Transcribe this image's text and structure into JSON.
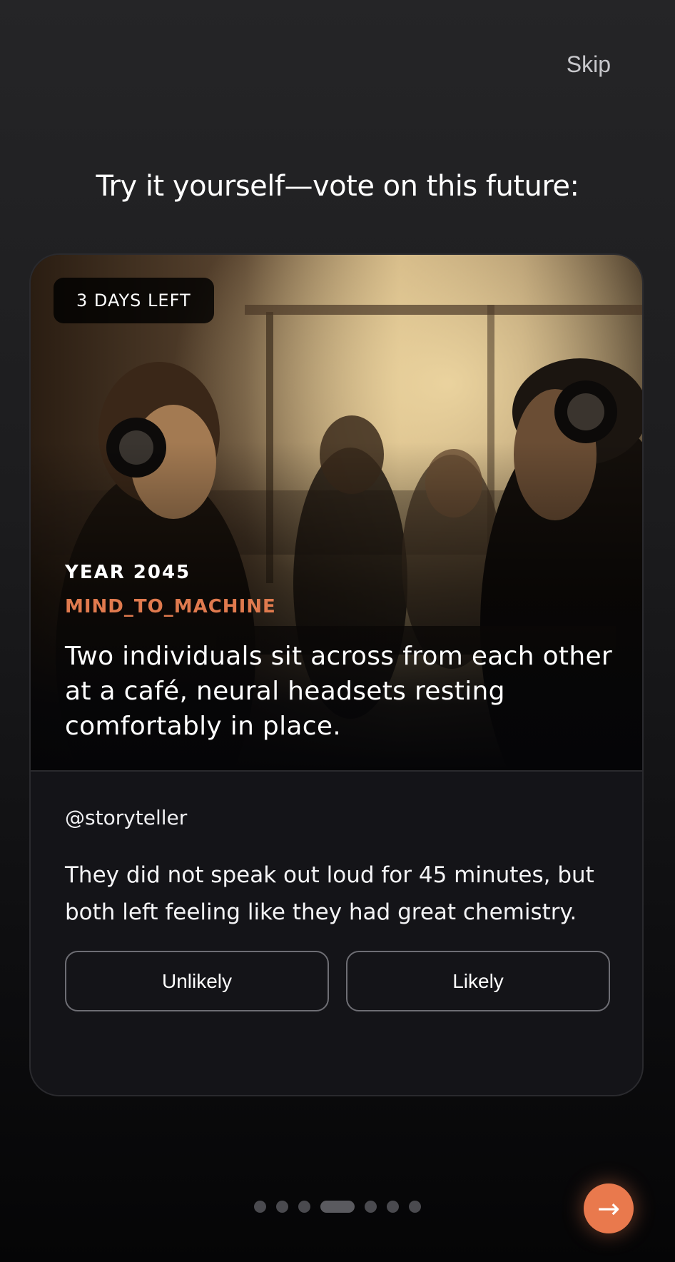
{
  "header": {
    "skip_label": "Skip",
    "headline": "Try it yourself—vote on this future:"
  },
  "card": {
    "badge": "3 DAYS LEFT",
    "year": "YEAR 2045",
    "category": "MIND_TO_MACHINE",
    "scene": "Two individuals sit across from each other at a café, neural headsets resting comfortably in place.",
    "author": "@storyteller",
    "story": "They did not speak out loud for 45 minutes, but both left feeling like they had great chemistry.",
    "vote_unlikely": "Unlikely",
    "vote_likely": "Likely"
  },
  "pager": {
    "total": 7,
    "active_index": 3
  },
  "next_button": {
    "icon": "arrow-right-icon",
    "glyph": "→"
  },
  "colors": {
    "accent": "#e9794d",
    "category": "#e07a4e"
  }
}
